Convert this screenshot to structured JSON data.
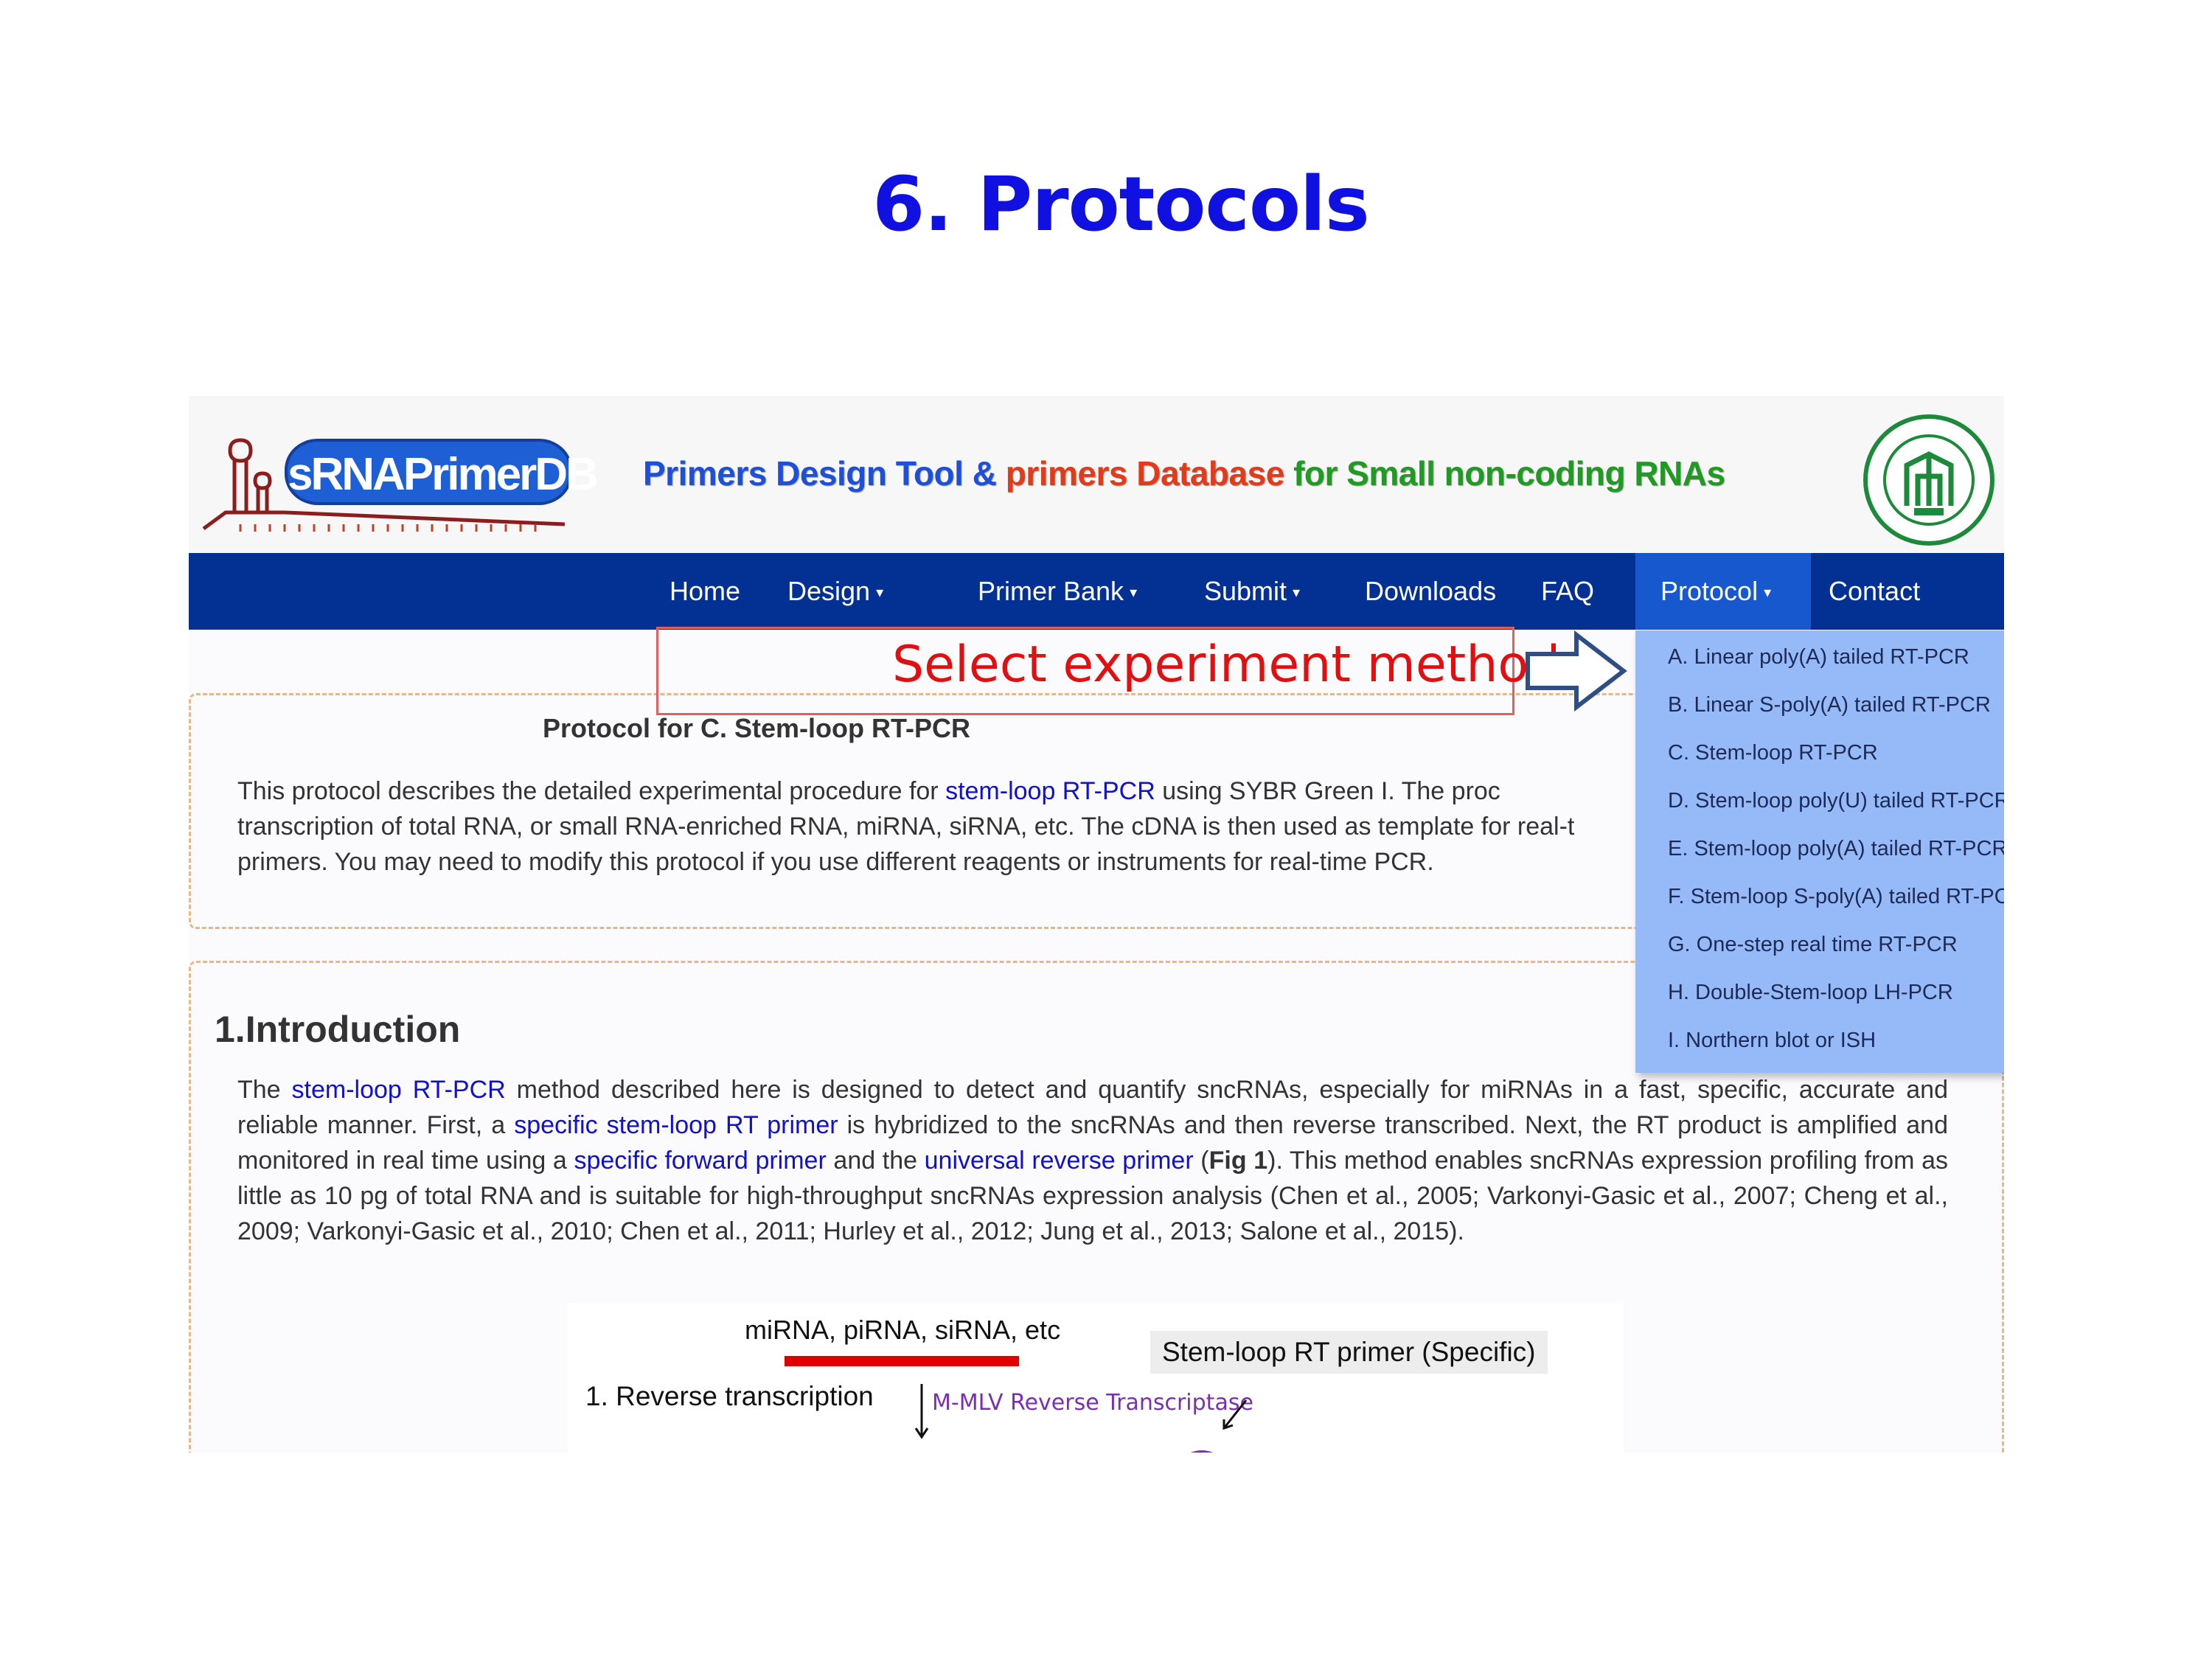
{
  "slide": {
    "title": "6. Protocols"
  },
  "header": {
    "logo_text": "sRNAPrimerDB",
    "tagline": {
      "part1": "Primers Design Tool & ",
      "part2": "primers Database",
      "part3": " for Small non-coding RNAs"
    },
    "colors": {
      "blue": "#1e4fd8",
      "red": "#e23b1a",
      "green": "#1f9a22"
    }
  },
  "nav": {
    "bar_color": "#023093",
    "active_color": "#1758cf",
    "items": [
      {
        "label": "Home"
      },
      {
        "label": "Design",
        "caret": "▾"
      },
      {
        "label": "Primer Bank",
        "caret": "▾"
      },
      {
        "label": "Submit",
        "caret": "▾"
      },
      {
        "label": "Downloads"
      },
      {
        "label": "FAQ"
      },
      {
        "label": "Protocol",
        "caret": "▾"
      },
      {
        "label": "Contact"
      }
    ]
  },
  "dropdown": {
    "items": [
      "A. Linear poly(A) tailed RT-PCR",
      "B. Linear S-poly(A) tailed RT-PCR",
      "C. Stem-loop RT-PCR",
      "D. Stem-loop poly(U) tailed RT-PCR",
      "E. Stem-loop poly(A) tailed RT-PCR",
      "F. Stem-loop S-poly(A) tailed RT-PCR",
      "G. One-step real time RT-PCR",
      "H. Double-Stem-loop LH-PCR",
      "I. Northern blot or ISH"
    ]
  },
  "annotation": {
    "text": "Select experiment method"
  },
  "protocol": {
    "title": "Protocol for C. Stem-loop RT-PCR",
    "p1": "This protocol describes the detailed experimental procedure for",
    "p1_link": "stem-loop RT-PCR",
    "p1_b": "using SYBR Green I. The proc",
    "p2": "transcription of total RNA, or small RNA-enriched RNA, miRNA, siRNA, etc. The cDNA is then used as template for real-t",
    "p3": "primers. You may need to modify this protocol if you use different reagents or instruments for real-time PCR."
  },
  "intro": {
    "heading": "1.Introduction",
    "s1": "The",
    "l1": "stem-loop RT-PCR",
    "s2": "method described here is designed to detect and quantify sncRNAs, especially for miRNAs in a fast, specific, accurate and reliable manner. First, a",
    "l2": "specific stem-loop RT primer",
    "s3": "is hybridized to the sncRNAs and then reverse transcribed. Next, the RT product is amplified and monitored in real time using a",
    "l3": "specific forward primer",
    "s4": "and the",
    "l4": "universal reverse primer",
    "s5": "(",
    "fig": "Fig 1",
    "s6": "). This method enables sncRNAs expression profiling from as little as 10 pg of total RNA and is suitable for high-throughput sncRNAs expression analysis (Chen et al., 2005; Varkonyi-Gasic et al., 2007; Cheng et al., 2009; Varkonyi-Gasic et al., 2010; Chen et al., 2011; Hurley et al., 2012; Jung et al., 2013; Salone et al., 2015)."
  },
  "figure": {
    "rna_label": "miRNA,  piRNA,  siRNA,  etc",
    "primer_label": "Stem-loop  RT primer  (Specific)",
    "step1": "1. Reverse transcription",
    "enzyme": "M-MLV Reverse Transcriptase"
  }
}
